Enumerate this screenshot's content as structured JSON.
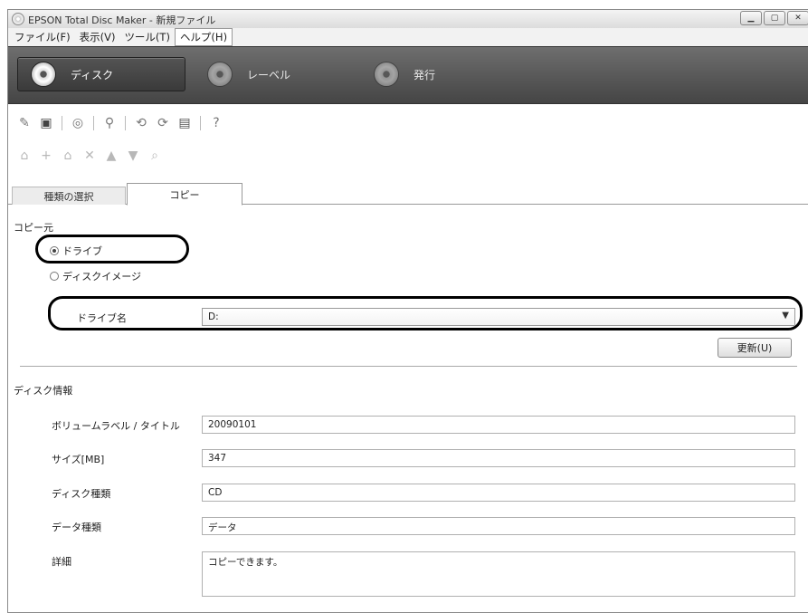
{
  "window": {
    "title": "EPSON Total Disc Maker - 新規ファイル",
    "controls": [
      "minimize-icon",
      "maximize-icon",
      "close-icon"
    ]
  },
  "menu": [
    "ファイル(F)",
    "表示(V)",
    "ツール(T)",
    "ヘルプ(H)"
  ],
  "modes": [
    {
      "label": "ディスク",
      "selected": true
    },
    {
      "label": "レーベル",
      "selected": false
    },
    {
      "label": "発行",
      "selected": false
    }
  ],
  "toolbar1_icons": [
    "new-icon",
    "save-icon",
    "preview-icon",
    "settings-icon",
    "import-icon",
    "export-icon",
    "print-icon",
    "help-icon"
  ],
  "toolbar2_icons": [
    "add-folder-icon",
    "add-file-icon",
    "add-item-icon",
    "delete-icon",
    "move-up-icon",
    "move-down-icon",
    "find-icon"
  ],
  "tabs": [
    {
      "label": "種類の選択",
      "active": false
    },
    {
      "label": "コピー",
      "active": true
    }
  ],
  "copy_source": {
    "heading": "コピー元",
    "options": [
      {
        "label": "ドライブ",
        "checked": true
      },
      {
        "label": "ディスクイメージ",
        "checked": false
      }
    ],
    "drive_label": "ドライブ名",
    "drive_value": "D:",
    "refresh_label": "更新(U)"
  },
  "disc_info": {
    "heading": "ディスク情報",
    "fields": [
      {
        "label": "ボリュームラベル / タイトル",
        "value": "20090101"
      },
      {
        "label": "サイズ[MB]",
        "value": "347"
      },
      {
        "label": "ディスク種類",
        "value": "CD"
      },
      {
        "label": "データ種類",
        "value": "データ"
      },
      {
        "label": "詳細",
        "value": "コピーできます。"
      }
    ]
  },
  "colors": {
    "modebar": "#555555",
    "highlight": "#000000"
  }
}
